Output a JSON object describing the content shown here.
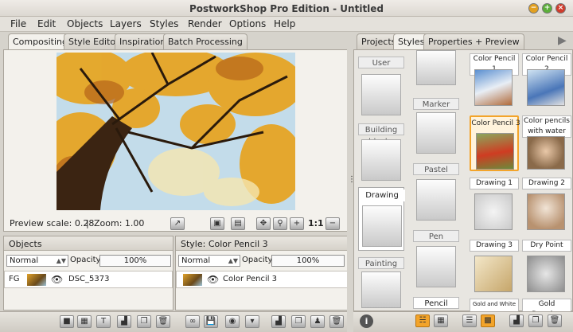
{
  "window": {
    "title": "PostworkShop Pro Edition - Untitled",
    "min": "−",
    "max": "+",
    "close": "×"
  },
  "menu": [
    "File",
    "Edit",
    "Objects",
    "Layers",
    "Styles",
    "Render",
    "Options",
    "Help"
  ],
  "left_tabs": [
    "Compositing",
    "Style Editor",
    "Inspiration",
    "Batch Processing"
  ],
  "right_tabs": [
    "Projects",
    "Styles",
    "Properties + Preview"
  ],
  "status": {
    "preview_scale": "Preview scale: 0.28",
    "separator": "|",
    "zoom": "Zoom: 1.00",
    "ratio": "1:1"
  },
  "objects": {
    "header": "Objects",
    "mode": "Normal",
    "opacity_label": "Opacity:",
    "opacity": "100%",
    "row_tag": "FG",
    "row_name": "DSC_5373"
  },
  "style_panel": {
    "header": "Style: Color Pencil 3",
    "mode": "Normal",
    "opacity_label": "Opacity:",
    "opacity": "100%",
    "row_name": "Color Pencil 3"
  },
  "categories_left": [
    "User",
    "Building blocks",
    "Drawing",
    "Painting"
  ],
  "categories_mid": [
    "Marker",
    "Pastel",
    "Pen",
    "Pencil"
  ],
  "styles": [
    [
      "Color Pencil 1",
      "Color Pencil 2"
    ],
    [
      "Color Pencil 3",
      "Color pencils with water"
    ],
    [
      "Drawing 1",
      "Drawing 2"
    ],
    [
      "Drawing 3",
      "Dry Point"
    ],
    [
      "Gold and White Illustration",
      "Gold Drawing"
    ]
  ],
  "colors": {
    "accent": "#f3a42a",
    "bg": "#d6d3cc"
  }
}
